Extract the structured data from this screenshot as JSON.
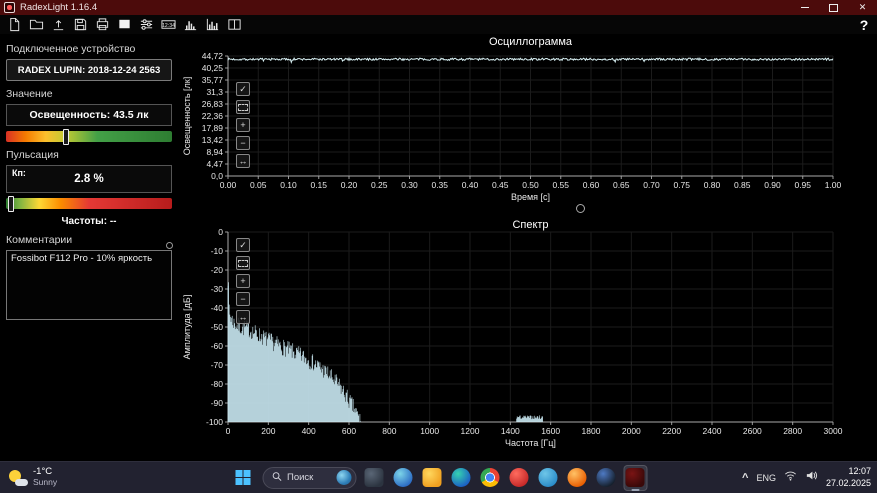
{
  "window": {
    "title": "RadexLight 1.16.4",
    "close_glyph": "✕"
  },
  "toolbar": {
    "help_label": "?",
    "clock_icon_text": "12:34",
    "buttons": [
      {
        "name": "new-file-button",
        "icon": "file-new"
      },
      {
        "name": "open-file-button",
        "icon": "folder-open"
      },
      {
        "name": "export-button",
        "icon": "export-arrow"
      },
      {
        "name": "save-button",
        "icon": "save-floppy"
      },
      {
        "name": "print-button",
        "icon": "printer"
      },
      {
        "name": "white-screen-button",
        "icon": "white-square"
      },
      {
        "name": "settings-button",
        "icon": "sliders"
      },
      {
        "name": "time-mode-button",
        "icon": "clock-1234"
      },
      {
        "name": "histogram-button",
        "icon": "histogram"
      },
      {
        "name": "spectrum-view-button",
        "icon": "bar-chart"
      },
      {
        "name": "layout-button",
        "icon": "split-panels"
      }
    ]
  },
  "sidebar": {
    "device": {
      "heading": "Подключенное устройство",
      "name": "RADEX LUPIN: 2018-12-24 2563"
    },
    "value": {
      "heading": "Значение",
      "illuminance": "Освещенность: 43.5 лк",
      "slider_pos_pct": 36
    },
    "pulsation": {
      "heading": "Пульсация",
      "kp_label": "Кп:",
      "kp_value": "2.8 %",
      "freq_label": "Частоты: --",
      "slider_pos_pct": 3
    },
    "comments": {
      "heading": "Комментарии",
      "text": "Fossibot F112 Pro - 10% яркость"
    }
  },
  "chart_tools": [
    {
      "name": "cursor-button",
      "glyph": "cursor"
    },
    {
      "name": "zoom-window-button",
      "glyph": "zoom-window"
    },
    {
      "name": "zoom-in-button",
      "glyph": "zoom-in"
    },
    {
      "name": "zoom-out-button",
      "glyph": "zoom-out"
    },
    {
      "name": "pan-button",
      "glyph": "pan"
    }
  ],
  "chart_data": [
    {
      "type": "line",
      "title": "Осциллограмма",
      "xlabel": "Время [с]",
      "ylabel": "Освещенность [лк]",
      "xlim": [
        0,
        1
      ],
      "ylim": [
        0,
        44.72
      ],
      "grid": true,
      "x_ticks": [
        "0.00",
        "0.05",
        "0.10",
        "0.15",
        "0.20",
        "0.25",
        "0.30",
        "0.35",
        "0.40",
        "0.45",
        "0.50",
        "0.55",
        "0.60",
        "0.65",
        "0.70",
        "0.75",
        "0.80",
        "0.85",
        "0.90",
        "0.95",
        "1.00"
      ],
      "y_ticks": [
        "44,72",
        "40,25",
        "35,77",
        "31,3",
        "26,83",
        "22,36",
        "17,89",
        "13,42",
        "8,94",
        "4,47",
        "0,0"
      ],
      "series": [
        {
          "name": "illuminance",
          "unit": "лк",
          "mean": 43.5,
          "noise_pp": 0.8,
          "description": "near-constant illuminance ≈43.5 lx across 0–1 s"
        }
      ],
      "line_color": "#d9f1f4"
    },
    {
      "type": "line",
      "title": "Спектр",
      "xlabel": "Частота [Гц]",
      "ylabel": "Амплитуда [дБ]",
      "xlim": [
        0,
        3000
      ],
      "ylim": [
        -100,
        0
      ],
      "grid": true,
      "x_ticks": [
        "0",
        "200",
        "400",
        "600",
        "800",
        "1000",
        "1200",
        "1400",
        "1600",
        "1800",
        "2000",
        "2200",
        "2400",
        "2600",
        "2800",
        "3000"
      ],
      "y_ticks": [
        "0",
        "-10",
        "-20",
        "-30",
        "-40",
        "-50",
        "-60",
        "-70",
        "-80",
        "-90",
        "-100"
      ],
      "series": [
        {
          "name": "amplitude-spectrum",
          "unit": "дБ",
          "peak_at_0_db": -27,
          "noise_db": 9,
          "envelope_points": [
            [
              0,
              -30
            ],
            [
              10,
              -44
            ],
            [
              30,
              -48
            ],
            [
              60,
              -50
            ],
            [
              100,
              -51
            ],
            [
              150,
              -54
            ],
            [
              200,
              -57
            ],
            [
              260,
              -60
            ],
            [
              320,
              -63
            ],
            [
              380,
              -66
            ],
            [
              440,
              -70
            ],
            [
              500,
              -75
            ],
            [
              560,
              -82
            ],
            [
              620,
              -92
            ],
            [
              660,
              -100
            ],
            [
              3000,
              -100
            ]
          ],
          "minor_bumps": [
            [
              1430,
              1560,
              -97.5
            ]
          ],
          "description": "noise spectrum from ≈-30 dB near 0 Hz falling to -100 dB by ≈650 Hz, flat beyond"
        }
      ],
      "line_color": "#c9e8f2"
    }
  ],
  "taskbar": {
    "weather": {
      "temp": "-1°C",
      "condition": "Sunny"
    },
    "search": {
      "placeholder": "Поиск"
    },
    "apps": [
      {
        "name": "task-view",
        "shape": "rounded",
        "c1": "#5a6676",
        "c2": "#2c3440"
      },
      {
        "name": "copilot",
        "shape": "circle",
        "c1": "#7cd4e8",
        "c2": "#2b6bc4"
      },
      {
        "name": "file-explorer",
        "shape": "rounded",
        "c1": "#ffd75e",
        "c2": "#f0a020"
      },
      {
        "name": "edge",
        "shape": "circle",
        "c1": "#35d2b0",
        "c2": "#1b5fc4"
      },
      {
        "name": "chrome",
        "shape": "circle",
        "c1": "#ea4335",
        "c2": "#34a853"
      },
      {
        "name": "opera",
        "shape": "circle",
        "c1": "#ff6b5e",
        "c2": "#c62828"
      },
      {
        "name": "telegram",
        "shape": "circle",
        "c1": "#6ec6e8",
        "c2": "#2a8bc8"
      },
      {
        "name": "firefox",
        "shape": "circle",
        "c1": "#ffc266",
        "c2": "#e85d00"
      },
      {
        "name": "steam",
        "shape": "circle",
        "c1": "#4e7ac4",
        "c2": "#16202d"
      },
      {
        "name": "radexlight",
        "shape": "rounded",
        "c1": "#7a1414",
        "c2": "#3a0808",
        "active": true
      }
    ],
    "tray": {
      "chevron": "^",
      "language": "ENG",
      "time": "12:07",
      "date": "27.02.2025"
    }
  }
}
